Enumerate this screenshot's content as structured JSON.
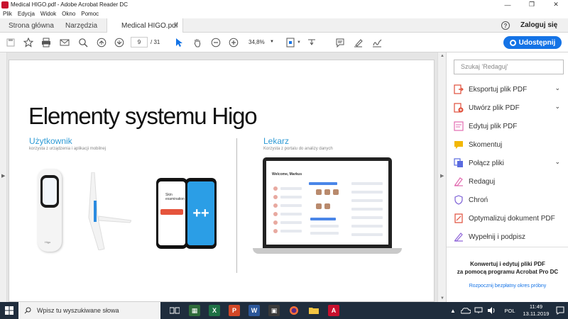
{
  "window": {
    "title": "Medical HIGO.pdf - Adobe Acrobat Reader DC",
    "controls": [
      "—",
      "❐",
      "✕"
    ]
  },
  "menu": [
    "Plik",
    "Edycja",
    "Widok",
    "Okno",
    "Pomoc"
  ],
  "tabs": {
    "home": "Strona główna",
    "tools": "Narzędzia",
    "document": "Medical HIGO.pdf",
    "close": "×"
  },
  "header": {
    "help": "?",
    "sign_in": "Zaloguj się",
    "share": "Udostępnij"
  },
  "toolbar": {
    "page_current": "9",
    "page_total": "/ 31",
    "zoom": "34,8%"
  },
  "document": {
    "title": "Elementy systemu Higo",
    "user_heading": "Użytkownik",
    "user_sub": "korzysta z urządzenia i aplikacji mobilnej",
    "doctor_heading": "Lekarz",
    "doctor_sub": "Korzysta z portalu do analizy danych",
    "device_label": "Higo",
    "phone_text": "Skin examination",
    "phone_logo": "++",
    "laptop_header": "Welcome, Markus"
  },
  "right_panel": {
    "search_placeholder": "Szukaj 'Redaguj'",
    "tools": [
      {
        "label": "Eksportuj plik PDF",
        "color": "#e04e39",
        "expand": true
      },
      {
        "label": "Utwórz plik PDF",
        "color": "#e04e39",
        "expand": true
      },
      {
        "label": "Edytuj plik PDF",
        "color": "#e26ab0",
        "expand": false
      },
      {
        "label": "Skomentuj",
        "color": "#f2b705",
        "expand": false
      },
      {
        "label": "Połącz pliki",
        "color": "#5a6be0",
        "expand": true
      },
      {
        "label": "Redaguj",
        "color": "#e26ab0",
        "expand": false
      },
      {
        "label": "Chroń",
        "color": "#7b5fd6",
        "expand": false
      },
      {
        "label": "Optymalizuj dokument PDF",
        "color": "#e04e39",
        "expand": false
      },
      {
        "label": "Wypełnij i podpisz",
        "color": "#8e63d8",
        "expand": false
      }
    ],
    "promo_line1": "Konwertuj i edytuj pliki PDF",
    "promo_line2": "za pomocą programu Acrobat Pro DC",
    "trial_link": "Rozpocznij bezpłatny okres próbny"
  },
  "taskbar": {
    "search_placeholder": "Wpisz tu wyszukiwane słowa",
    "language": "POL",
    "time": "11:49",
    "date": "13.11.2019"
  }
}
